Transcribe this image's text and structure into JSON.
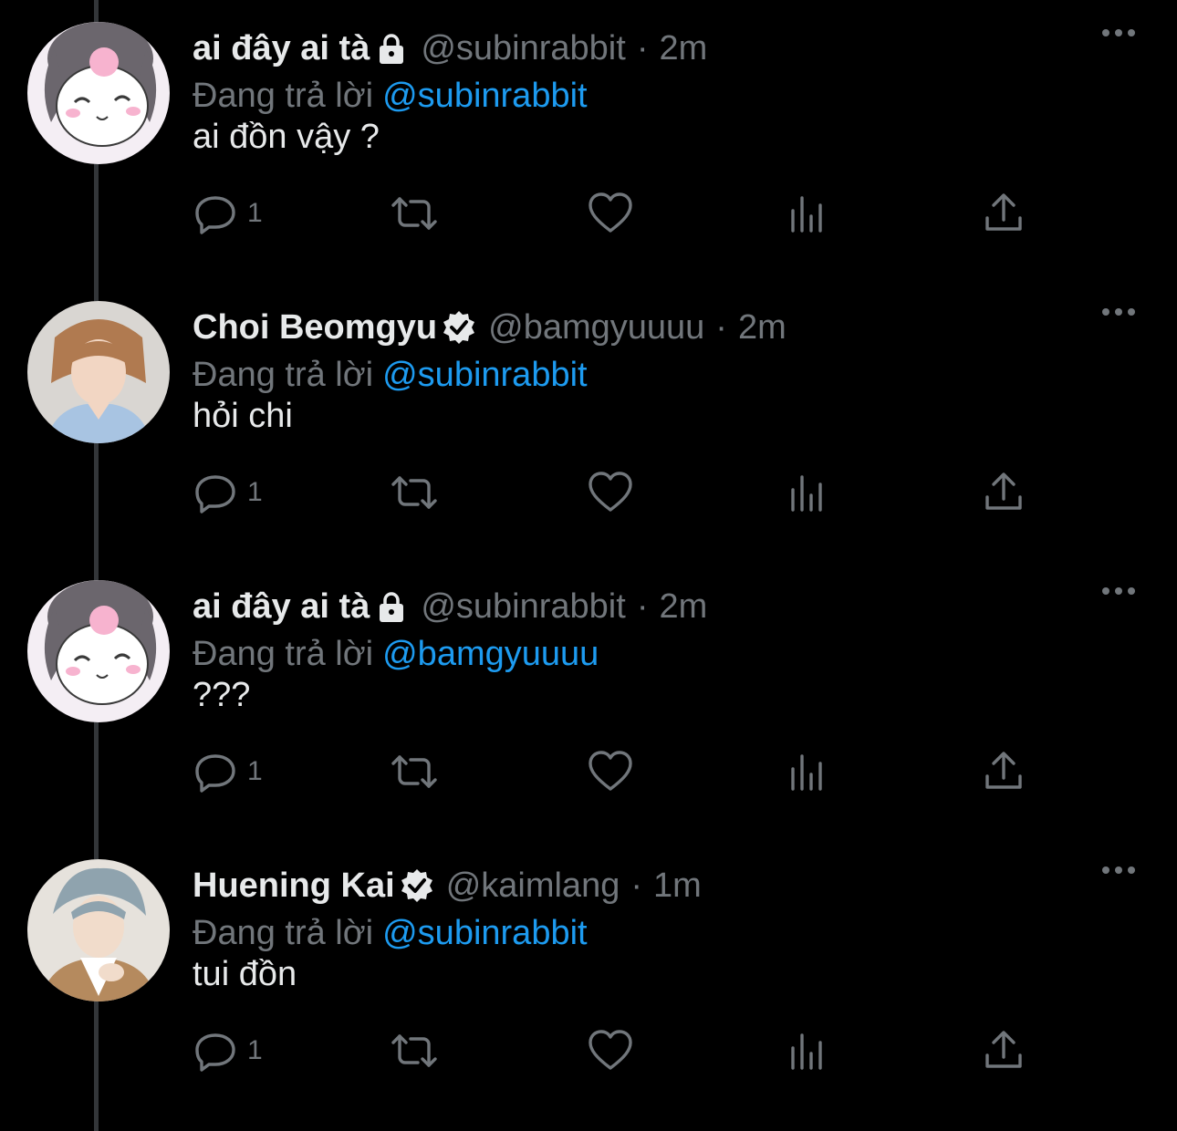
{
  "tweets": [
    {
      "name": "ai đây ai tà",
      "badge": "lock-icon",
      "handle": "@subinrabbit",
      "dot": "·",
      "time": "2m",
      "reply_prefix": "Đang trả lời",
      "reply_to": "@subinrabbit",
      "text": "ai đồn vậy ?",
      "reply_count": "1",
      "avatar": "kuromi-avatar"
    },
    {
      "name": "Choi Beomgyu",
      "badge": "verified-icon",
      "handle": "@bamgyuuuu",
      "dot": "·",
      "time": "2m",
      "reply_prefix": "Đang trả lời",
      "reply_to": "@subinrabbit",
      "text": "hỏi chi",
      "reply_count": "1",
      "avatar": "photo-avatar"
    },
    {
      "name": "ai đây ai tà",
      "badge": "lock-icon",
      "handle": "@subinrabbit",
      "dot": "·",
      "time": "2m",
      "reply_prefix": "Đang trả lời",
      "reply_to": "@bamgyuuuu",
      "text": "???",
      "reply_count": "1",
      "avatar": "kuromi-avatar"
    },
    {
      "name": "Huening Kai",
      "badge": "verified-icon",
      "handle": "@kaimlang",
      "dot": "·",
      "time": "1m",
      "reply_prefix": "Đang trả lời",
      "reply_to": "@subinrabbit",
      "text": "tui đồn",
      "reply_count": "1",
      "avatar": "photo-avatar"
    }
  ],
  "colors": {
    "background": "#000000",
    "primary_text": "#e7e9ea",
    "secondary_text": "#71767b",
    "link": "#1d9bf0",
    "thread_line": "#333639"
  }
}
